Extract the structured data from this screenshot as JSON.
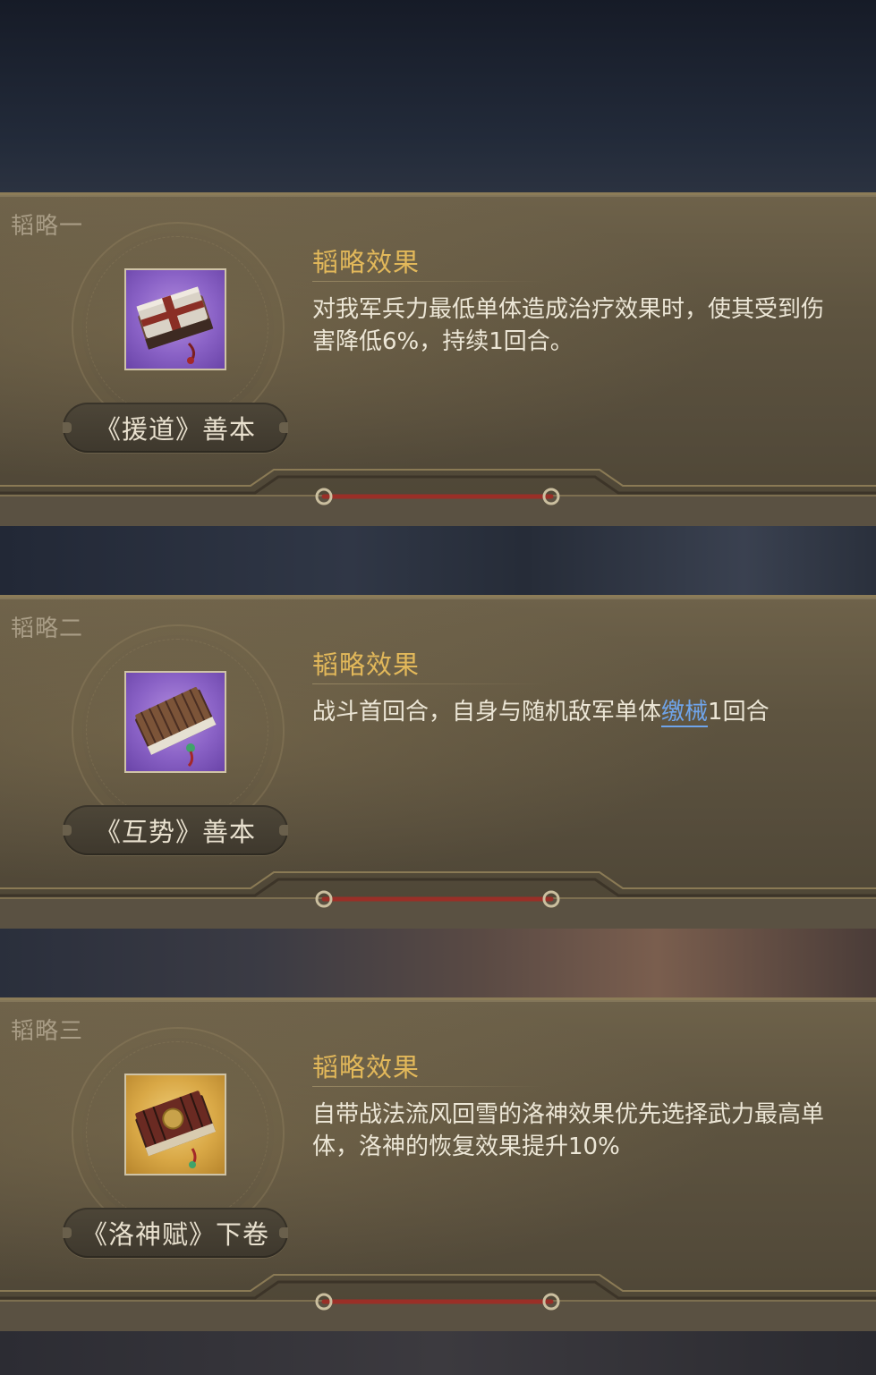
{
  "cards": [
    {
      "label": "韬略一",
      "item_name": "《援道》善本",
      "effect_title": "韬略效果",
      "effect_text": "对我军兵力最低单体造成治疗效果时，使其受到伤害降低6%，持续1回合。",
      "icon": "bundled-scrolls-icon",
      "icon_bg": "purple"
    },
    {
      "label": "韬略二",
      "item_name": "《互势》善本",
      "effect_title": "韬略效果",
      "effect_text_before": "战斗首回合，自身与随机敌军单体",
      "effect_keyword": "缴械",
      "effect_text_after": "1回合",
      "icon": "bamboo-book-icon",
      "icon_bg": "purple"
    },
    {
      "label": "韬略三",
      "item_name": "《洛神赋》下卷",
      "effect_title": "韬略效果",
      "effect_text": "自带战法流风回雪的洛神效果优先选择武力最高单体，洛神的恢复效果提升10%",
      "icon": "ornate-book-icon",
      "icon_bg": "gold"
    }
  ],
  "colors": {
    "effect_title": "#e2b85a",
    "keyword": "#6fa4ea",
    "panel": "#5e5440"
  }
}
